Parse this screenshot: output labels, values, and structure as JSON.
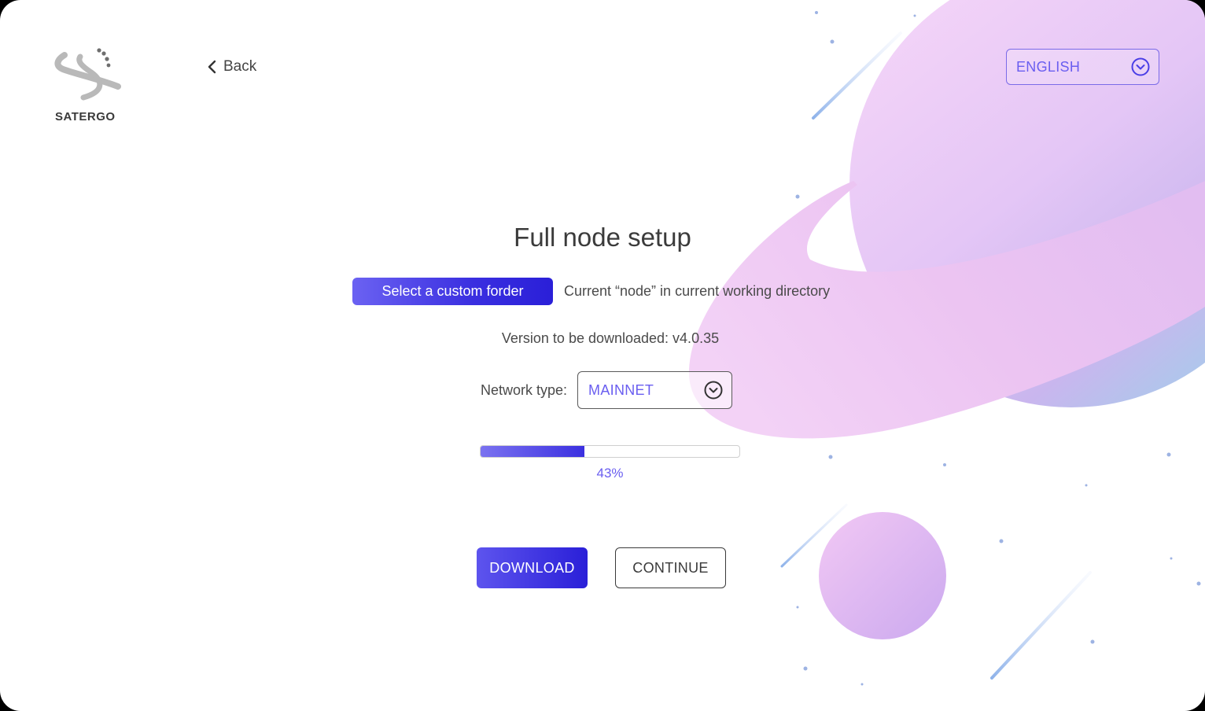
{
  "brand": {
    "name": "SATERGO"
  },
  "nav": {
    "back_label": "Back"
  },
  "language": {
    "selected": "ENGLISH"
  },
  "main": {
    "title": "Full node setup",
    "folder_button_label": "Select a custom forder",
    "folder_note": "Current “node” in current working directory",
    "version_text": "Version to be downloaded: v4.0.35",
    "network_label": "Network type:",
    "network_selected": "MAINNET",
    "progress_text": "43%"
  },
  "actions": {
    "download_label": "DOWNLOAD",
    "continue_label": "CONTINUE"
  },
  "icons": {
    "back": "chevron-left-icon",
    "dropdown": "chevron-down-circle-icon"
  },
  "colors": {
    "accent": "#3a2fe0",
    "accent_light": "#6a5ef0",
    "planet_pink": "#f0c8f4",
    "planet_purple": "#d4b8f4",
    "planet_blue": "#9fd0ea"
  }
}
